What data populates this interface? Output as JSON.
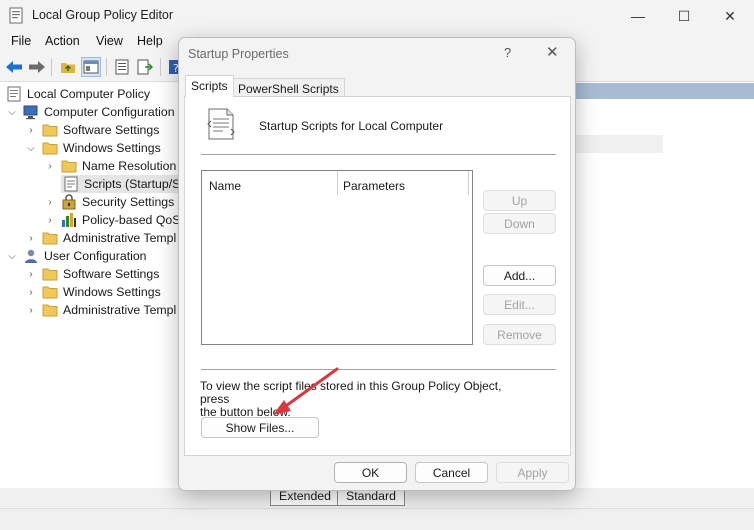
{
  "window": {
    "title": "Local Group Policy Editor",
    "controls": {
      "minimize": "—",
      "maximize": "☐",
      "close": "✕"
    }
  },
  "menu": [
    "File",
    "Action",
    "View",
    "Help"
  ],
  "tree": {
    "root": "Local Computer Policy",
    "items": [
      "Computer Configuration",
      "Software Settings",
      "Windows Settings",
      "Name Resolution",
      "Scripts (Startup/Sh",
      "Security Settings",
      "Policy-based QoS",
      "Administrative Templ",
      "User Configuration",
      "Software Settings",
      "Windows Settings",
      "Administrative Templ"
    ]
  },
  "bottom_tabs": [
    "Extended",
    "Standard"
  ],
  "dialog": {
    "title": "Startup Properties",
    "help": "?",
    "close": "✕",
    "tabs": [
      "Scripts",
      "PowerShell Scripts"
    ],
    "heading": "Startup Scripts for Local Computer",
    "columns": [
      "Name",
      "Parameters"
    ],
    "buttons": {
      "up": "Up",
      "down": "Down",
      "add": "Add...",
      "edit": "Edit...",
      "remove": "Remove",
      "show_files": "Show Files...",
      "ok": "OK",
      "cancel": "Cancel",
      "apply": "Apply"
    },
    "info_line1": "To view the script files stored in this Group Policy Object, press",
    "info_line2": "the button below."
  },
  "colors": {
    "annotation_arrow": "#d9363e",
    "selection": "#e5e5e5"
  }
}
